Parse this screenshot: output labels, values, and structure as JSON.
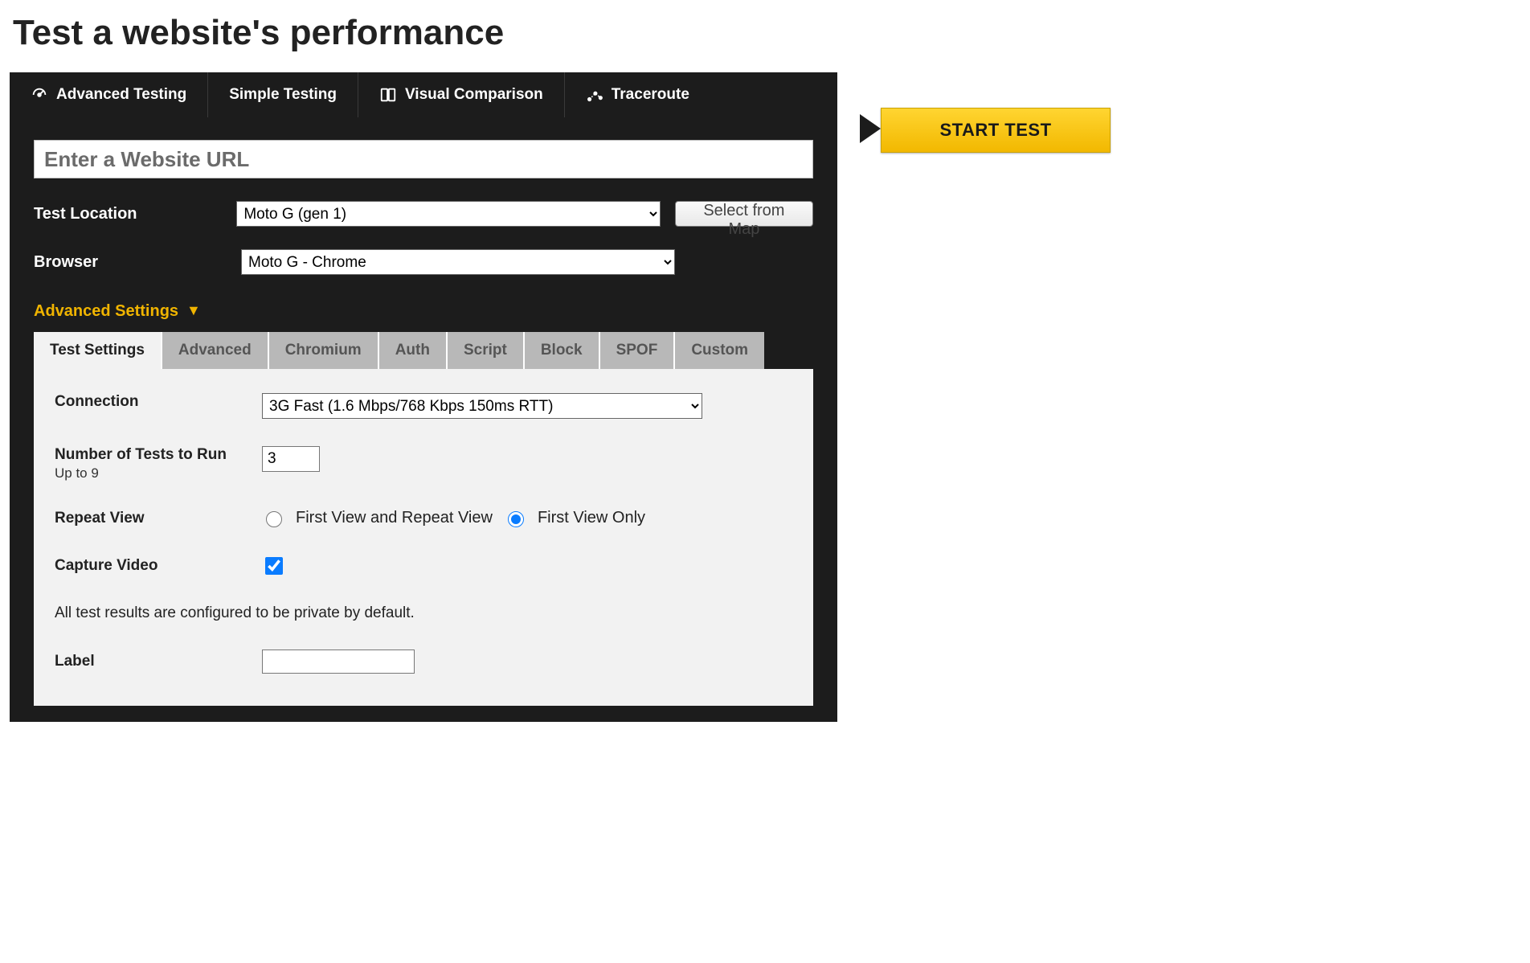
{
  "page": {
    "title": "Test a website's performance"
  },
  "nav": {
    "items": [
      {
        "label": "Advanced Testing"
      },
      {
        "label": "Simple Testing"
      },
      {
        "label": "Visual Comparison"
      },
      {
        "label": "Traceroute"
      }
    ]
  },
  "start_button": "START TEST",
  "url_field": {
    "placeholder": "Enter a Website URL",
    "value": ""
  },
  "location": {
    "label": "Test Location",
    "selected": "Moto G (gen 1)",
    "map_button": "Select from Map"
  },
  "browser": {
    "label": "Browser",
    "selected": "Moto G - Chrome"
  },
  "advanced_toggle": "Advanced Settings",
  "settings_tabs": [
    "Test Settings",
    "Advanced",
    "Chromium",
    "Auth",
    "Script",
    "Block",
    "SPOF",
    "Custom"
  ],
  "test_settings": {
    "connection": {
      "label": "Connection",
      "selected": "3G Fast (1.6 Mbps/768 Kbps 150ms RTT)"
    },
    "runs": {
      "label": "Number of Tests to Run",
      "hint": "Up to 9",
      "value": "3"
    },
    "repeat_view": {
      "label": "Repeat View",
      "option_both": "First View and Repeat View",
      "option_first": "First View Only"
    },
    "capture_video": {
      "label": "Capture Video"
    },
    "private_note": "All test results are configured to be private by default.",
    "label_field": {
      "label": "Label",
      "value": ""
    }
  }
}
